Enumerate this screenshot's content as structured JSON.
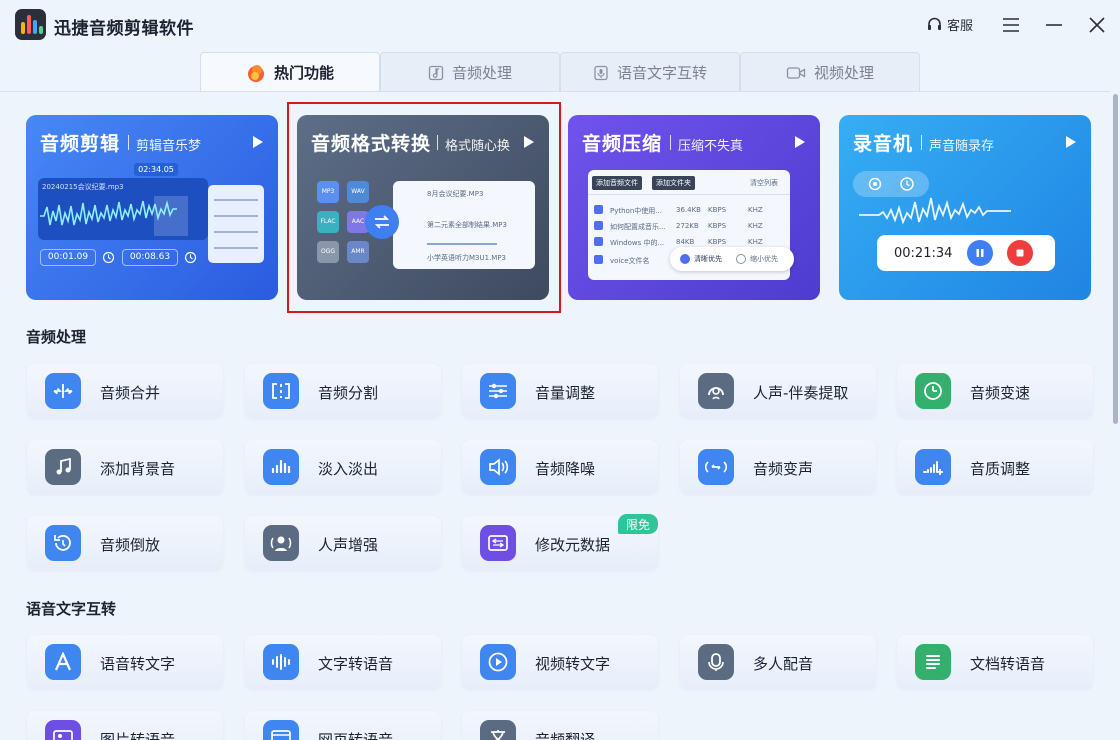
{
  "app": {
    "title": "迅捷音频剪辑软件",
    "support_label": "客服"
  },
  "tabs": [
    {
      "label": "热门功能",
      "icon": "fire-icon",
      "active": true
    },
    {
      "label": "音频处理",
      "icon": "music-doc-icon",
      "active": false
    },
    {
      "label": "语音文字互转",
      "icon": "mic-doc-icon",
      "active": false
    },
    {
      "label": "视频处理",
      "icon": "video-camera-icon",
      "active": false
    }
  ],
  "hero_cards": [
    {
      "title": "音频剪辑",
      "subtitle": "剪辑音乐梦",
      "color_from": "#3f7ff2",
      "color_to": "#2d5fe0",
      "preview": {
        "file": "20240215会议纪要.mp3",
        "time": "02:34.05",
        "start": "00:01.09",
        "end": "00:08.63"
      }
    },
    {
      "title": "音频格式转换",
      "subtitle": "格式随心换",
      "color_from": "#5a6a83",
      "color_to": "#3f4c62",
      "preview": {
        "formats": [
          "MP3",
          "WAV",
          "FLAC",
          "AAC",
          "OGG",
          "AMR"
        ],
        "files": [
          "8月会议纪要.MP3",
          "第二元素全部制结果.MP3",
          "小学英语听力M3U1.MP3"
        ]
      }
    },
    {
      "title": "音频压缩",
      "subtitle": "压缩不失真",
      "color_from": "#6a4de6",
      "color_to": "#4f3fd1",
      "preview": {
        "add_file": "添加音频文件",
        "add_folder": "添加文件夹",
        "clear": "清空列表",
        "rows": [
          {
            "name": "Python中使用...",
            "size": "36.4KB",
            "unit": "KBPS",
            "rate": "KHZ"
          },
          {
            "name": "如何配置成音乐...",
            "size": "272KB",
            "unit": "KBPS",
            "rate": "KHZ"
          },
          {
            "name": "Windows 中的...",
            "size": "84KB",
            "unit": "KBPS",
            "rate": "KHZ"
          },
          {
            "name": "voice文件名",
            "size": "",
            "unit": "",
            "rate": ""
          }
        ],
        "option_clear": "清晰优先",
        "option_small": "缩小优先"
      }
    },
    {
      "title": "录音机",
      "subtitle": "声音随录存",
      "color_from": "#2fa8f2",
      "color_to": "#1e86e4",
      "preview": {
        "timer": "00:21:34"
      }
    }
  ],
  "sections": [
    {
      "title": "音频处理",
      "items": [
        {
          "label": "音频合并",
          "icon": "merge-icon",
          "color": "#3f86f0"
        },
        {
          "label": "音频分割",
          "icon": "split-icon",
          "color": "#3f86f0"
        },
        {
          "label": "音量调整",
          "icon": "sliders-icon",
          "color": "#3f86f0"
        },
        {
          "label": "人声-伴奏提取",
          "icon": "vocal-extract-icon",
          "color": "#5b6b82"
        },
        {
          "label": "音频变速",
          "icon": "speed-icon",
          "color": "#34b06e"
        },
        {
          "label": "添加背景音",
          "icon": "music-note-icon",
          "color": "#5b6b82"
        },
        {
          "label": "淡入淡出",
          "icon": "fade-bars-icon",
          "color": "#3f86f0"
        },
        {
          "label": "音频降噪",
          "icon": "speaker-icon",
          "color": "#3f86f0"
        },
        {
          "label": "音频变声",
          "icon": "voice-change-icon",
          "color": "#3f86f0"
        },
        {
          "label": "音质调整",
          "icon": "quality-bars-icon",
          "color": "#3f86f0"
        },
        {
          "label": "音频倒放",
          "icon": "reverse-icon",
          "color": "#3f86f0"
        },
        {
          "label": "人声增强",
          "icon": "voice-enhance-icon",
          "color": "#5b6b82"
        },
        {
          "label": "修改元数据",
          "icon": "metadata-icon",
          "color": "#6f4fe3",
          "badge": "限免"
        }
      ]
    },
    {
      "title": "语音文字互转",
      "items": [
        {
          "label": "语音转文字",
          "icon": "letter-a-icon",
          "color": "#3f86f0"
        },
        {
          "label": "文字转语音",
          "icon": "waveform-icon",
          "color": "#3f86f0"
        },
        {
          "label": "视频转文字",
          "icon": "play-circle-icon",
          "color": "#3f86f0"
        },
        {
          "label": "多人配音",
          "icon": "multi-voice-icon",
          "color": "#5b6b82"
        },
        {
          "label": "文档转语音",
          "icon": "document-lines-icon",
          "color": "#34b06e"
        },
        {
          "label": "图片转语音",
          "icon": "image-icon",
          "color": "#6f4fe3"
        },
        {
          "label": "网页转语音",
          "icon": "web-icon",
          "color": "#3f86f0"
        },
        {
          "label": "音频翻译",
          "icon": "translate-icon",
          "color": "#5b6b82"
        }
      ]
    }
  ]
}
